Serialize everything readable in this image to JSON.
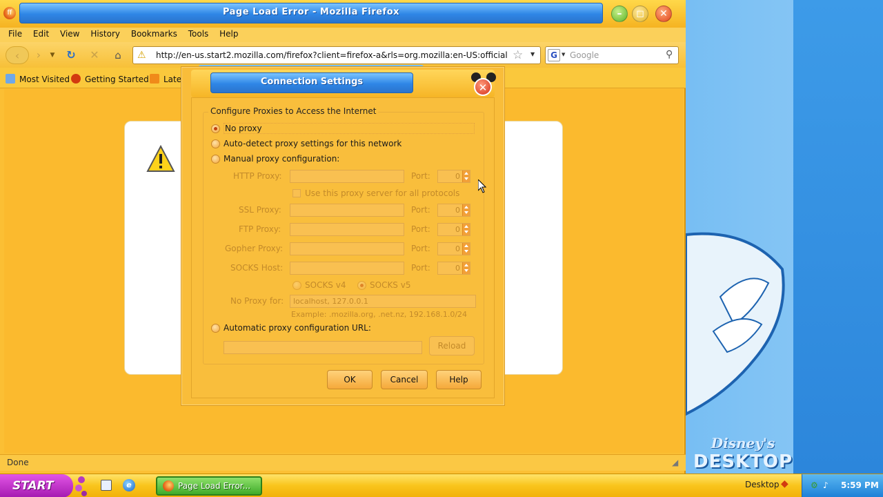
{
  "window": {
    "title": "Page Load Error - Mozilla Firefox"
  },
  "menu": [
    "File",
    "Edit",
    "View",
    "History",
    "Bookmarks",
    "Tools",
    "Help"
  ],
  "navigation": {
    "url": "http://en-us.start2.mozilla.com/firefox?client=firefox-a&rls=org.mozilla:en-US:official",
    "search_placeholder": "Google",
    "search_engine_letter": "G"
  },
  "bookmarks": {
    "most_visited": "Most Visited",
    "getting_started": "Getting Started",
    "latest": "Late"
  },
  "status": {
    "text": "Done"
  },
  "dialog": {
    "title": "Connection Settings",
    "group_caption": "Configure Proxies to Access the Internet",
    "no_proxy": "No proxy",
    "auto_detect": "Auto-detect proxy settings for this network",
    "manual": "Manual proxy configuration:",
    "http_proxy": "HTTP Proxy:",
    "ssl_proxy": "SSL Proxy:",
    "ftp_proxy": "FTP Proxy:",
    "gopher_proxy": "Gopher Proxy:",
    "socks_host": "SOCKS Host:",
    "port_label": "Port:",
    "port_value": "0",
    "use_same": "Use this proxy server for all protocols",
    "socks_v4": "SOCKS v4",
    "socks_v5": "SOCKS v5",
    "no_proxy_for": "No Proxy for:",
    "no_proxy_for_value": "localhost, 127.0.0.1",
    "example": "Example: .mozilla.org, .net.nz, 192.168.1.0/24",
    "auto_url": "Automatic proxy configuration URL:",
    "reload": "Reload",
    "ok": "OK",
    "cancel": "Cancel",
    "help": "Help",
    "selected_option": "No proxy"
  },
  "taskbar": {
    "start": "START",
    "task_item": "Page Load Error...",
    "desktop_label": "Desktop",
    "clock": "5:59 PM"
  },
  "branding": {
    "disney_line1": "Disney's",
    "disney_line2": "DESKTOP"
  },
  "colors": {
    "accent_blue": "#2f86e6",
    "window_orange": "#fbbf34",
    "start_purple": "#c23ccc"
  }
}
